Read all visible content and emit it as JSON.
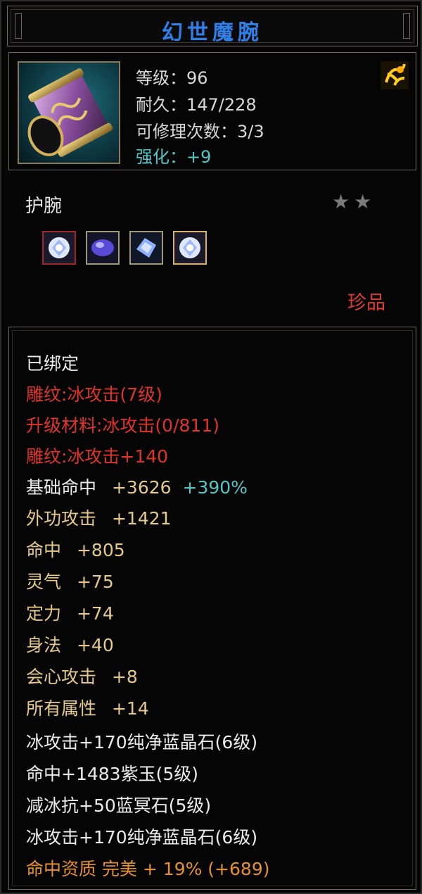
{
  "title": "幻世魔腕",
  "header": {
    "level": "等级：96",
    "durability": "耐久：147/228",
    "repairs": "可修理次数：3/3",
    "enhance": "强化：+9"
  },
  "item_type": "护腕",
  "stars": "★★",
  "rarity": "珍品",
  "gems": [
    "ice-gem-icon",
    "purple-jade-icon",
    "blue-crystal-icon",
    "ice-gem-icon"
  ],
  "details": {
    "bound": "已绑定",
    "engrave1": "雕纹:冰攻击(7级)",
    "upgrade": "升级材料:冰攻击(0/811)",
    "engrave2": "雕纹:冰攻击+140",
    "base_hit_label": "基础命中",
    "base_hit_value": "+3626",
    "base_hit_pct": "+390%",
    "attrs": [
      {
        "label": "外功攻击",
        "value": "+1421"
      },
      {
        "label": "命中",
        "value": "+805"
      },
      {
        "label": "灵气",
        "value": "+75"
      },
      {
        "label": "定力",
        "value": "+74"
      },
      {
        "label": "身法",
        "value": "+40"
      },
      {
        "label": "会心攻击",
        "value": "+8"
      },
      {
        "label": "所有属性",
        "value": "+14"
      }
    ],
    "gem_lines": [
      "冰攻击+170纯净蓝晶石(6级)",
      "命中+1483紫玉(5级)",
      "减冰抗+50蓝冥石(5级)",
      "冰攻击+170纯净蓝晶石(6级)"
    ],
    "quality": "命中资质 完美 + 19% (+689)"
  }
}
